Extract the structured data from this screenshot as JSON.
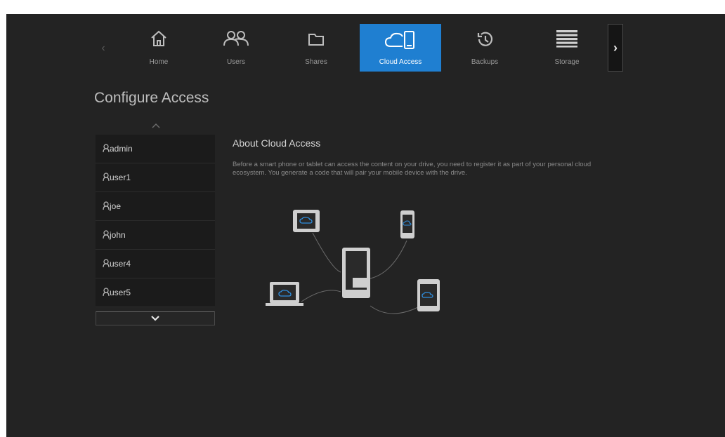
{
  "nav": {
    "tabs": [
      {
        "label": "Home",
        "icon": "home-icon"
      },
      {
        "label": "Users",
        "icon": "users-icon"
      },
      {
        "label": "Shares",
        "icon": "folder-icon"
      },
      {
        "label": "Cloud Access",
        "icon": "cloud-device-icon",
        "active": true
      },
      {
        "label": "Backups",
        "icon": "history-icon"
      },
      {
        "label": "Storage",
        "icon": "storage-icon"
      }
    ],
    "prev_glyph": "‹",
    "next_glyph": "›"
  },
  "page": {
    "title": "Configure Access"
  },
  "users": [
    "admin",
    "user1",
    "joe",
    "john",
    "user4",
    "user5"
  ],
  "about": {
    "title": "About Cloud Access",
    "text": "Before a smart phone or tablet can access the content on your drive, you need to register it as part of your personal cloud ecosystem. You generate a code that will pair your mobile device with the drive."
  },
  "colors": {
    "accent": "#1f7fd1",
    "background": "#232323",
    "list_bg": "#1b1b1b"
  }
}
